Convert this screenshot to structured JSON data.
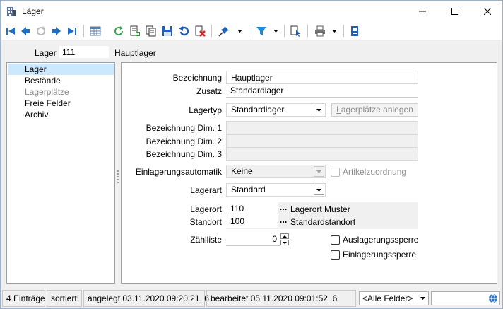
{
  "window": {
    "title": "Läger",
    "accent": "#0078d7"
  },
  "toolbar": {
    "icons": [
      "first-record-icon",
      "prev-record-icon",
      "refresh-disabled-icon",
      "next-record-icon",
      "last-record-icon",
      "table-view-icon",
      "reload-icon",
      "new-record-icon",
      "copy-record-icon",
      "save-icon",
      "undo-icon",
      "delete-icon",
      "pin-icon",
      "filter-icon",
      "select-icon",
      "print-icon",
      "export-icon"
    ]
  },
  "header": {
    "lager_label": "Lager",
    "lager_value": "111",
    "lager_name": "Hauptlager"
  },
  "nav": {
    "items": [
      {
        "label": "Lager"
      },
      {
        "label": "Bestände"
      },
      {
        "label": "Lagerplätze"
      },
      {
        "label": "Freie Felder"
      },
      {
        "label": "Archiv"
      }
    ]
  },
  "form": {
    "bezeichnung_label": "Bezeichnung",
    "bezeichnung_value": "Hauptlager",
    "zusatz_label": "Zusatz",
    "zusatz_value": "Standardlager",
    "lagertyp_label": "Lagertyp",
    "lagertyp_value": "Standardlager",
    "lagerplaetze_button_prefix": "L",
    "lagerplaetze_button_rest": "agerplätze anlegen",
    "dim1_label": "Bezeichnung Dim. 1",
    "dim1_value": "",
    "dim2_label": "Bezeichnung Dim. 2",
    "dim2_value": "",
    "dim3_label": "Bezeichnung Dim. 3",
    "dim3_value": "",
    "einlagerung_label": "Einlagerungsautomatik",
    "einlagerung_value": "Keine",
    "artikelzuordnung_label": "Artikelzuordnung",
    "lagerart_label": "Lagerart",
    "lagerart_value": "Standard",
    "lagerort_label": "Lagerort",
    "lagerort_value": "110",
    "lagerort_name": "Lagerort Muster",
    "standort_label": "Standort",
    "standort_value": "100",
    "standort_name": "Standardstandort",
    "zaehlliste_label": "Zählliste",
    "zaehlliste_value": "0",
    "auslagerungssperre_label": "Auslagerungssperre",
    "einlagerungssperre_label": "Einlagerungssperre",
    "lookup_button_label": "..."
  },
  "status": {
    "count": "4 Einträge",
    "sorted": "sortiert:",
    "created": "angelegt 03.11.2020 09:20:21,  6",
    "edited": "bearbeitet 05.11.2020 09:01:52,  6",
    "field_filter": "<Alle Felder>",
    "search_value": ""
  }
}
